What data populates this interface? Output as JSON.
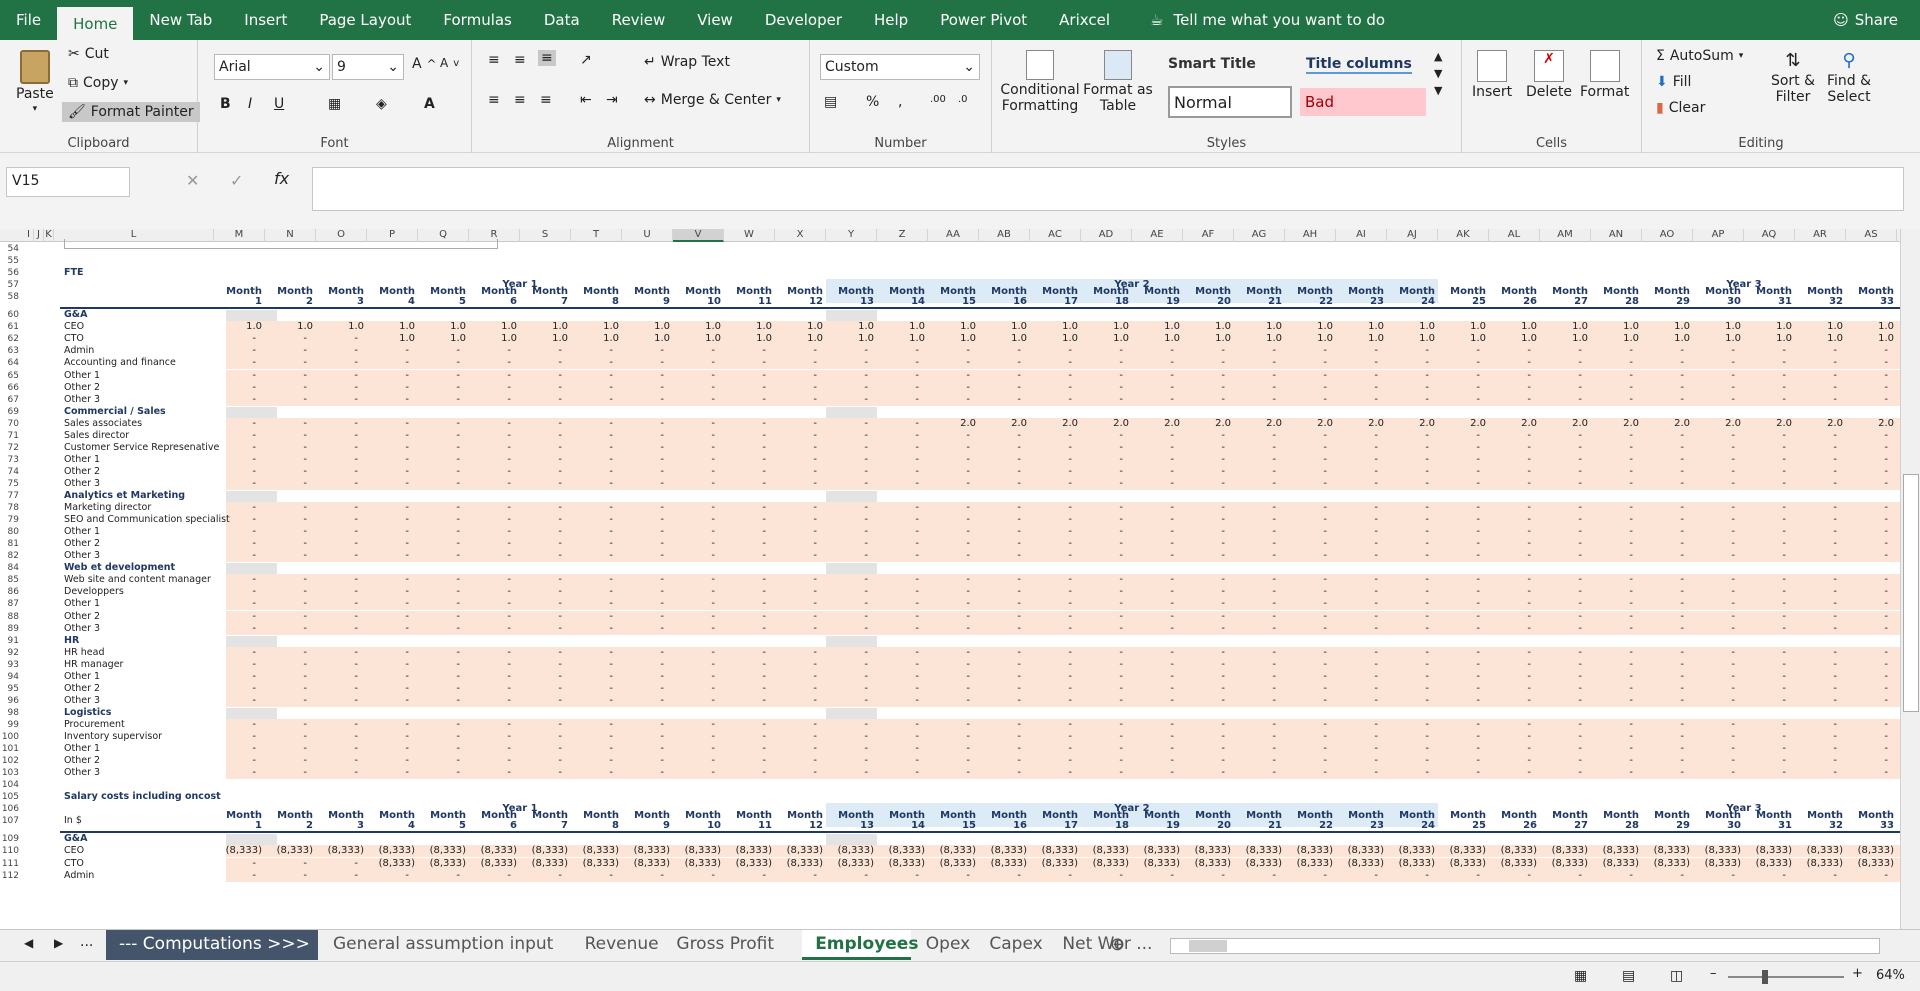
{
  "ribbon_tabs": [
    "File",
    "Home",
    "New Tab",
    "Insert",
    "Page Layout",
    "Formulas",
    "Data",
    "Review",
    "View",
    "Developer",
    "Help",
    "Power Pivot",
    "Arixcel"
  ],
  "tell_me": "Tell me what you want to do",
  "share": "Share",
  "clipboard": {
    "paste": "Paste",
    "cut": "Cut",
    "copy": "Copy",
    "format_painter": "Format Painter",
    "label": "Clipboard"
  },
  "font": {
    "name": "Arial",
    "size": "9",
    "label": "Font"
  },
  "alignment": {
    "wrap": "Wrap Text",
    "merge": "Merge & Center",
    "label": "Alignment"
  },
  "number": {
    "format": "Custom",
    "label": "Number"
  },
  "styles": {
    "conditional": "Conditional Formatting",
    "format_table": "Format as Table",
    "smart_title": "Smart Title",
    "title_columns": "Title columns",
    "normal": "Normal",
    "bad": "Bad",
    "label": "Styles"
  },
  "cells": {
    "insert": "Insert",
    "delete": "Delete",
    "format": "Format",
    "label": "Cells"
  },
  "editing": {
    "autosum": "AutoSum",
    "fill": "Fill",
    "clear": "Clear",
    "sort": "Sort & Filter",
    "find": "Find & Select",
    "label": "Editing"
  },
  "name_box": "V15",
  "columns": [
    "I",
    "J",
    "K",
    "L",
    "M",
    "N",
    "O",
    "P",
    "Q",
    "R",
    "S",
    "T",
    "U",
    "V",
    "W",
    "X",
    "Y",
    "Z",
    "AA",
    "AB",
    "AC",
    "AD",
    "AE",
    "AF",
    "AG",
    "AH",
    "AI",
    "AJ",
    "AK",
    "AL",
    "AM",
    "AN",
    "AO",
    "AP",
    "AQ",
    "AR",
    "AS"
  ],
  "fte_title": "FTE",
  "year_labels": [
    "Year 1",
    "Year 2",
    "Year 3"
  ],
  "month_label": "Month",
  "rows": [
    {
      "n": "54",
      "label": "",
      "type": "blank"
    },
    {
      "n": "55",
      "label": "",
      "type": "blank"
    },
    {
      "n": "56",
      "label": "FTE",
      "type": "title"
    },
    {
      "n": "57",
      "label": "",
      "type": "blank"
    },
    {
      "n": "58",
      "label": "",
      "type": "monthhdr"
    },
    {
      "n": "60",
      "label": "G&A",
      "type": "section"
    },
    {
      "n": "61",
      "label": "CEO",
      "type": "data",
      "v": "ceo"
    },
    {
      "n": "62",
      "label": "CTO",
      "type": "data",
      "v": "cto"
    },
    {
      "n": "63",
      "label": "Admin",
      "type": "data"
    },
    {
      "n": "64",
      "label": "Accounting and finance",
      "type": "data"
    },
    {
      "n": "65",
      "label": "Other 1",
      "type": "data"
    },
    {
      "n": "66",
      "label": "Other 2",
      "type": "data"
    },
    {
      "n": "67",
      "label": "Other 3",
      "type": "data"
    },
    {
      "n": "69",
      "label": "Commercial / Sales",
      "type": "section"
    },
    {
      "n": "70",
      "label": "Sales associates",
      "type": "data",
      "v": "sales"
    },
    {
      "n": "71",
      "label": "Sales director",
      "type": "data"
    },
    {
      "n": "72",
      "label": "Customer Service Represenative",
      "type": "data"
    },
    {
      "n": "73",
      "label": "Other 1",
      "type": "data"
    },
    {
      "n": "74",
      "label": "Other 2",
      "type": "data"
    },
    {
      "n": "75",
      "label": "Other 3",
      "type": "data"
    },
    {
      "n": "77",
      "label": "Analytics et Marketing",
      "type": "section"
    },
    {
      "n": "78",
      "label": "Marketing director",
      "type": "data"
    },
    {
      "n": "79",
      "label": "SEO and Communication specialist",
      "type": "data"
    },
    {
      "n": "80",
      "label": "Other 1",
      "type": "data"
    },
    {
      "n": "81",
      "label": "Other 2",
      "type": "data"
    },
    {
      "n": "82",
      "label": "Other 3",
      "type": "data"
    },
    {
      "n": "84",
      "label": "Web et development",
      "type": "section"
    },
    {
      "n": "85",
      "label": "Web site and content manager",
      "type": "data"
    },
    {
      "n": "86",
      "label": "Developpers",
      "type": "data"
    },
    {
      "n": "87",
      "label": "Other 1",
      "type": "data"
    },
    {
      "n": "88",
      "label": "Other 2",
      "type": "data"
    },
    {
      "n": "89",
      "label": "Other 3",
      "type": "data"
    },
    {
      "n": "91",
      "label": "HR",
      "type": "section"
    },
    {
      "n": "92",
      "label": "HR head",
      "type": "data"
    },
    {
      "n": "93",
      "label": "HR manager",
      "type": "data"
    },
    {
      "n": "94",
      "label": "Other 1",
      "type": "data"
    },
    {
      "n": "95",
      "label": "Other 2",
      "type": "data"
    },
    {
      "n": "96",
      "label": "Other 3",
      "type": "data"
    },
    {
      "n": "98",
      "label": "Logistics",
      "type": "section"
    },
    {
      "n": "99",
      "label": "Procurement",
      "type": "data"
    },
    {
      "n": "100",
      "label": "Inventory supervisor",
      "type": "data"
    },
    {
      "n": "101",
      "label": "Other 1",
      "type": "data"
    },
    {
      "n": "102",
      "label": "Other 2",
      "type": "data"
    },
    {
      "n": "103",
      "label": "Other 3",
      "type": "data"
    },
    {
      "n": "104",
      "label": "",
      "type": "blank"
    },
    {
      "n": "105",
      "label": "Salary costs including oncost",
      "type": "title"
    },
    {
      "n": "106",
      "label": "",
      "type": "blank"
    },
    {
      "n": "107",
      "label": "In $",
      "type": "monthhdr"
    },
    {
      "n": "109",
      "label": "G&A",
      "type": "section"
    },
    {
      "n": "110",
      "label": "CEO",
      "type": "data",
      "v": "ceo_cost"
    },
    {
      "n": "111",
      "label": "CTO",
      "type": "data",
      "v": "cto_cost"
    },
    {
      "n": "112",
      "label": "Admin",
      "type": "data"
    }
  ],
  "values": {
    "one": "1.0",
    "two": "2.0",
    "dash": "-",
    "cost": "(8,333)"
  },
  "sheet_tabs": [
    "--- Computations >>>",
    "General assumption input",
    "Revenue",
    "Gross Profit",
    "Employees",
    "Opex",
    "Capex",
    "Net Wor ..."
  ],
  "active_sheet": "Employees",
  "zoom": "64%"
}
